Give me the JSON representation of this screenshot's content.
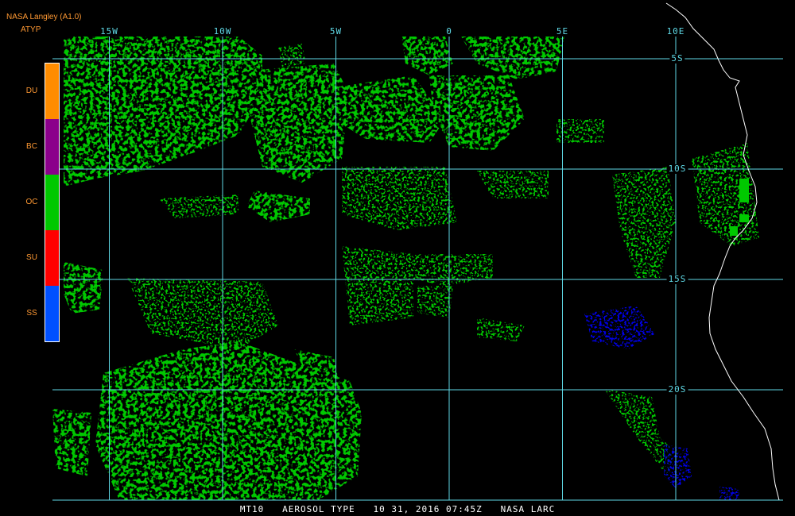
{
  "header": {
    "title": "NASA Langley (A1.0)",
    "product": "ATYP"
  },
  "legend": {
    "items": [
      {
        "label": "DU",
        "color": "#ff8c00"
      },
      {
        "label": "BC",
        "color": "#8b008b"
      },
      {
        "label": "OC",
        "color": "#00c800"
      },
      {
        "label": "SU",
        "color": "#ff0000"
      },
      {
        "label": "SS",
        "color": "#0050ff"
      }
    ]
  },
  "grid": {
    "color": "#5fd9e6",
    "longitudes": [
      "15W",
      "10W",
      "5W",
      "0",
      "5E",
      "10E"
    ],
    "latitudes": [
      "5S",
      "10S",
      "15S",
      "20S"
    ],
    "lon_values": [
      -15,
      -10,
      -5,
      0,
      5,
      10
    ],
    "lat_values": [
      -5,
      -10,
      -15,
      -20
    ]
  },
  "colors": {
    "label_color": "#ff9933",
    "grid_label_color": "#5fd9e6",
    "footer_color": "#ffffff",
    "coast_color": "#ffffff",
    "background": "#000000"
  },
  "footer": {
    "text": "MT10   AEROSOL TYPE   10 31, 2016 07:45Z   NASA LARC"
  }
}
